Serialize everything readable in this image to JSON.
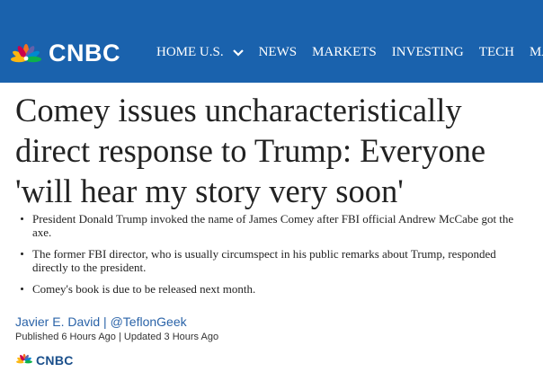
{
  "header": {
    "logo_text": "CNBC",
    "nav": [
      {
        "label": "HOME U.S."
      },
      {
        "label": "NEWS"
      },
      {
        "label": "MARKETS"
      },
      {
        "label": "INVESTING"
      },
      {
        "label": "TECH"
      },
      {
        "label": "MAKE IT"
      }
    ],
    "colors": {
      "bar": "#1a62ad"
    }
  },
  "article": {
    "headline": "Comey issues uncharacteristically direct response to Trump: Everyone 'will hear my story very soon'",
    "bullets": [
      "President Donald Trump invoked the name of James Comey after FBI official Andrew McCabe got the axe.",
      "The former FBI director, who is usually circumspect in his public remarks about Trump, responded directly to the president.",
      "Comey's book is due to be released next month."
    ],
    "author": "Javier E. David",
    "author_separator": "|",
    "twitter": "@TeflonGeek",
    "published": "Published 6 Hours Ago | Updated 3 Hours Ago"
  },
  "footer_logo": {
    "text": "CNBC"
  }
}
